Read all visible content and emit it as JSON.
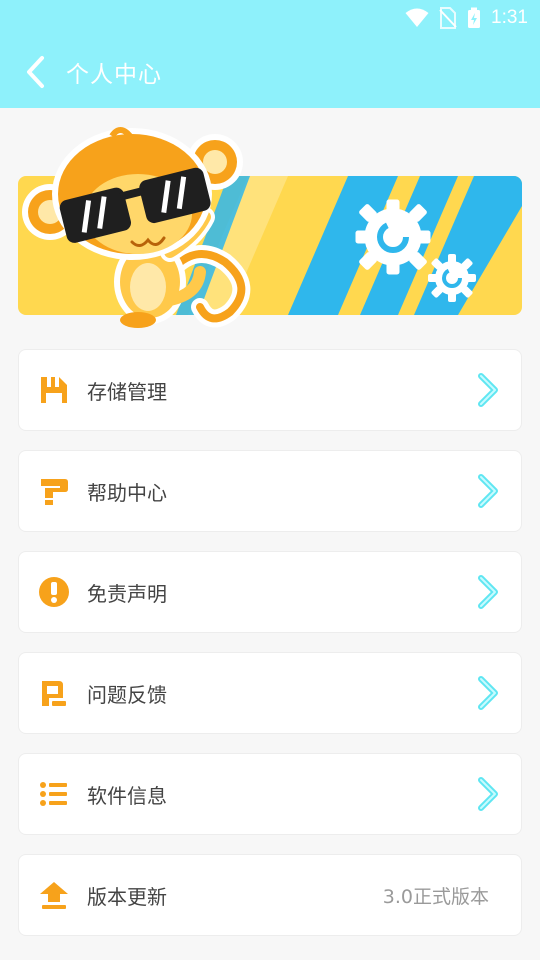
{
  "status_bar": {
    "time": "1:31"
  },
  "header": {
    "title": "个人中心",
    "back_icon": "chevron-left-icon"
  },
  "colors": {
    "accent": "#8ef1fb",
    "icon_orange": "#f7a21b",
    "arrow": "#5fe6f2",
    "banner_yellow": "#ffd84f"
  },
  "menu": {
    "items": [
      {
        "label": "存储管理",
        "icon": "storage-icon"
      },
      {
        "label": "帮助中心",
        "icon": "help-icon"
      },
      {
        "label": "免责声明",
        "icon": "disclaimer-icon"
      },
      {
        "label": "问题反馈",
        "icon": "feedback-icon"
      },
      {
        "label": "软件信息",
        "icon": "info-list-icon"
      },
      {
        "label": "版本更新",
        "icon": "update-icon",
        "value": "3.0正式版本"
      }
    ]
  }
}
